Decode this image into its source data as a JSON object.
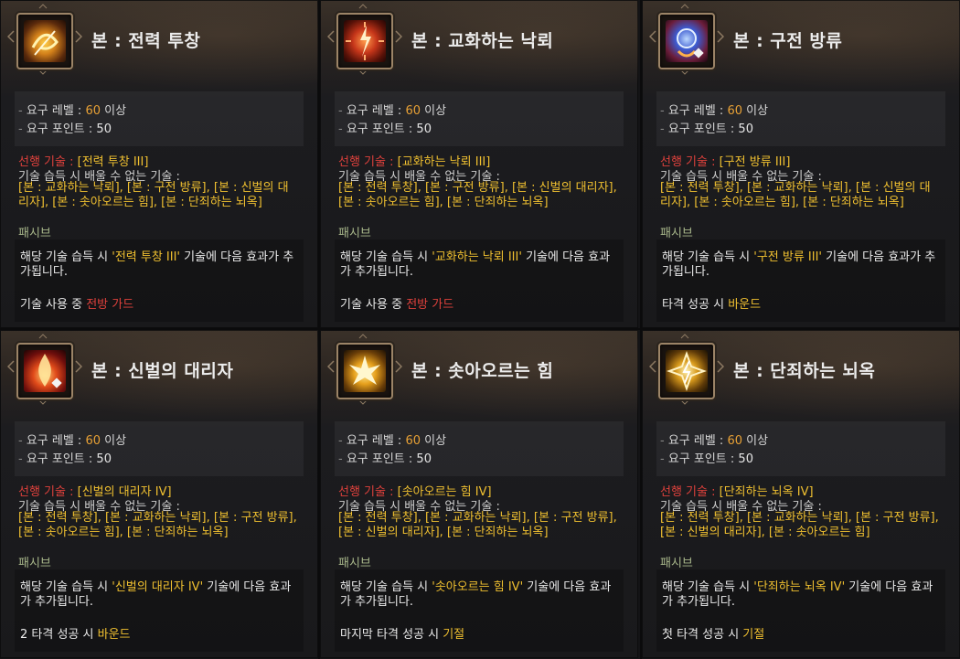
{
  "labels": {
    "req_level_label": "요구 레벨 :",
    "req_level_value": "60",
    "req_level_suffix": "이상",
    "req_points_label": "요구 포인트 :",
    "req_points_value": "50",
    "prereq_label": "선행 기술 :",
    "unlearnable_title": "기술 습득 시 배울 수 없는 기술 :",
    "passive": "패시브"
  },
  "colors": {
    "accent_gold": "#f0c030",
    "accent_orange": "#e8a135",
    "accent_red": "#e0413c",
    "passive_green": "#a9b88b"
  },
  "cards": [
    {
      "title": "본 : 전력 투창",
      "icon": "spear-vortex-icon",
      "prereq": "[전력 투창 III]",
      "unlearnable": "[본 : 교화하는 낙뢰], [본 : 구전 방류], [본 : 신벌의 대리자], [본 : 솟아오르는 힘], [본 : 단죄하는 뇌옥]",
      "desc_prefix": "해당 기술 습득 시 ",
      "desc_skill": "'전력 투창 III'",
      "desc_suffix": " 기술에 다음 효과가 추가됩니다.",
      "effect_prefix": "기술 사용 중 ",
      "effect_value": "전방 가드",
      "effect_color": "red"
    },
    {
      "title": "본 : 교화하는 낙뢰",
      "icon": "lightning-bolt-icon",
      "prereq": "[교화하는 낙뢰 III]",
      "unlearnable": "[본 : 전력 투창], [본 : 구전 방류], [본 : 신벌의 대리자], [본 : 솟아오르는 힘], [본 : 단죄하는 뇌옥]",
      "desc_prefix": "해당 기술 습득 시 ",
      "desc_skill": "'교화하는 낙뢰 III'",
      "desc_suffix": " 기술에 다음 효과가 추가됩니다.",
      "effect_prefix": "기술 사용 중 ",
      "effect_value": "전방 가드",
      "effect_color": "red"
    },
    {
      "title": "본 : 구전 방류",
      "icon": "sphere-discharge-icon",
      "prereq": "[구전 방류 III]",
      "unlearnable": "[본 : 전력 투창], [본 : 교화하는 낙뢰], [본 : 신벌의 대리자], [본 : 솟아오르는 힘], [본 : 단죄하는 뇌옥]",
      "desc_prefix": "해당 기술 습득 시 ",
      "desc_skill": "'구전 방류 III'",
      "desc_suffix": " 기술에 다음 효과가 추가됩니다.",
      "effect_prefix": "타격 성공 시 ",
      "effect_value": "바운드",
      "effect_color": "yellow"
    },
    {
      "title": "본 : 신벌의 대리자",
      "icon": "divine-flame-icon",
      "prereq": "[신벌의 대리자 IV]",
      "unlearnable": "[본 : 전력 투창], [본 : 교화하는 낙뢰], [본 : 구전 방류], [본 : 솟아오르는 힘], [본 : 단죄하는 뇌옥]",
      "desc_prefix": "해당 기술 습득 시 ",
      "desc_skill": "'신벌의 대리자 IV'",
      "desc_suffix": " 기술에 다음 효과가 추가됩니다.",
      "effect_prefix": "2 타격 성공 시 ",
      "effect_value": "바운드",
      "effect_color": "yellow"
    },
    {
      "title": "본 : 솟아오르는 힘",
      "icon": "rising-burst-icon",
      "prereq": "[솟아오르는 힘 IV]",
      "unlearnable": "[본 : 전력 투창], [본 : 교화하는 낙뢰], [본 : 구전 방류], [본 : 신벌의 대리자], [본 : 단죄하는 뇌옥]",
      "desc_prefix": "해당 기술 습득 시 ",
      "desc_skill": "'솟아오르는 힘 IV'",
      "desc_suffix": " 기술에 다음 효과가 추가됩니다.",
      "effect_prefix": "마지막 타격 성공 시 ",
      "effect_value": "기절",
      "effect_color": "yellow"
    },
    {
      "title": "본 : 단죄하는 뇌옥",
      "icon": "thunder-prison-icon",
      "prereq": "[단죄하는 뇌옥 IV]",
      "unlearnable": "[본 : 전력 투창], [본 : 교화하는 낙뢰], [본 : 구전 방류], [본 : 신벌의 대리자], [본 : 솟아오르는 힘]",
      "desc_prefix": "해당 기술 습득 시 ",
      "desc_skill": "'단죄하는 뇌옥 IV'",
      "desc_suffix": " 기술에 다음 효과가 추가됩니다.",
      "effect_prefix": "첫 타격 성공 시 ",
      "effect_value": "기절",
      "effect_color": "yellow"
    }
  ]
}
